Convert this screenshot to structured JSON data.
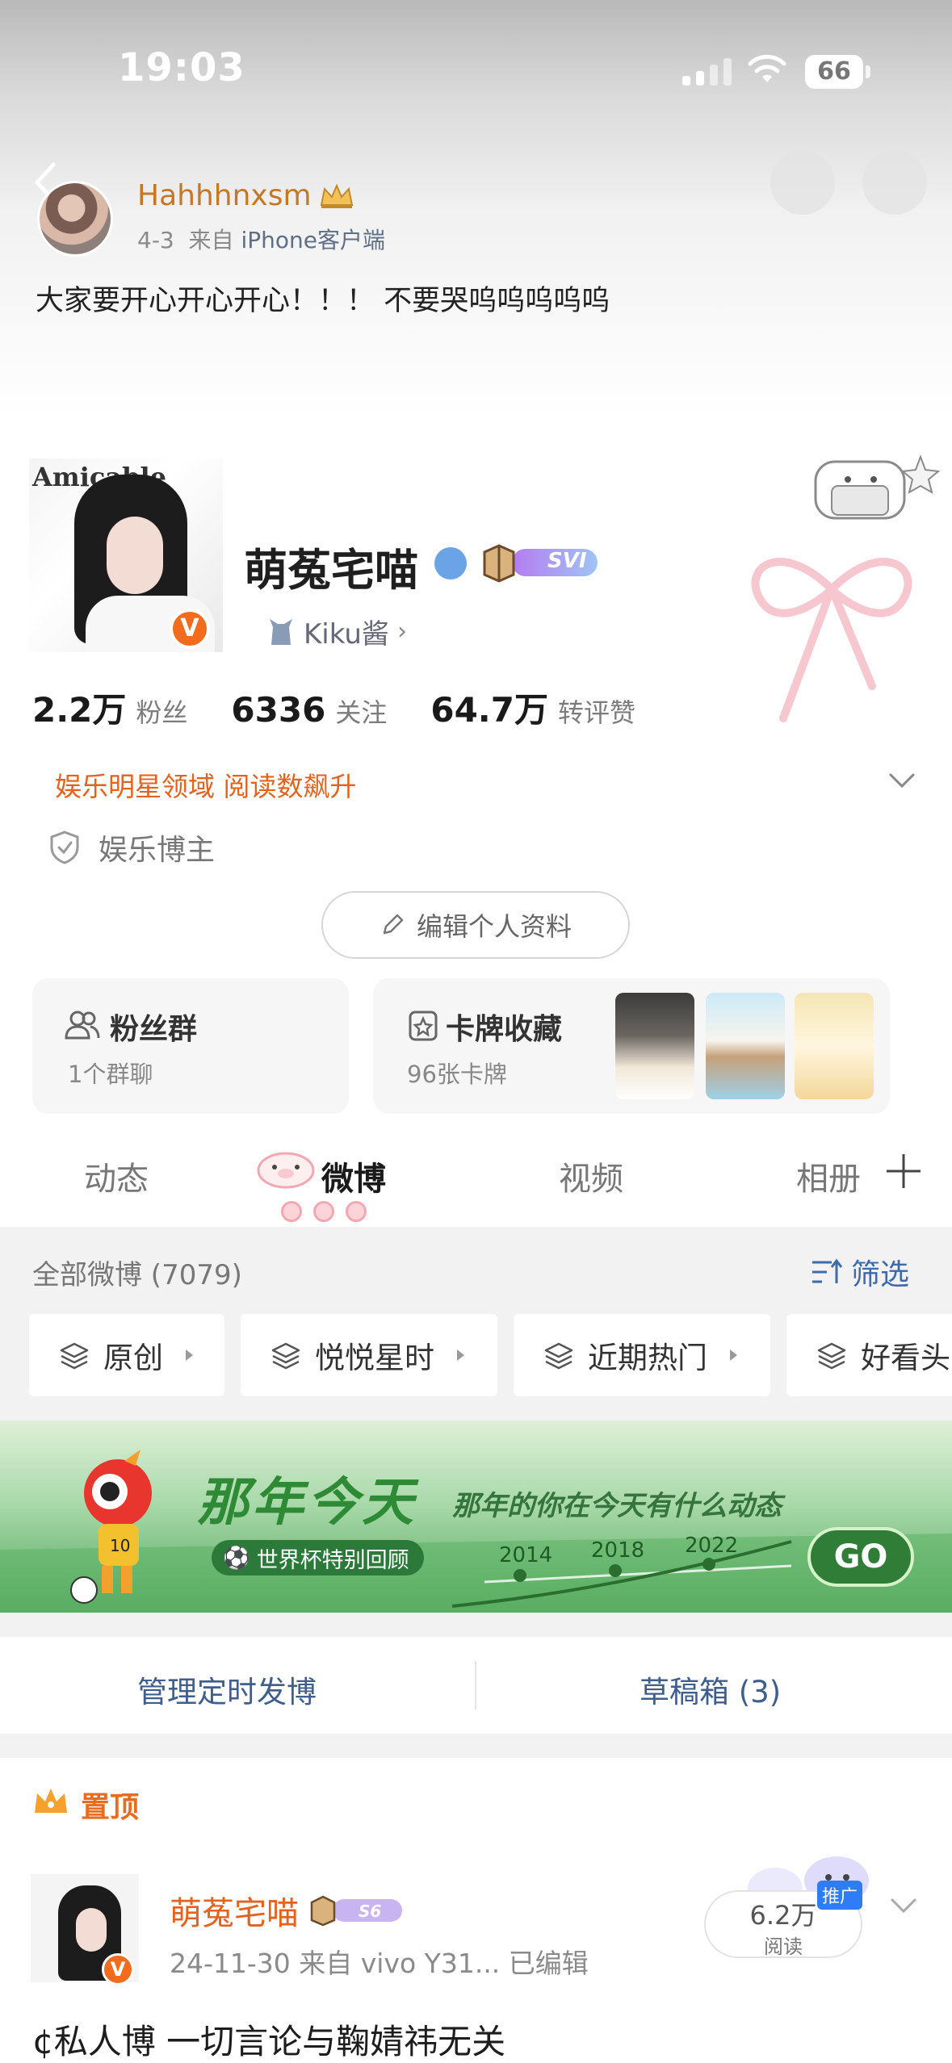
{
  "status_bar": {
    "time": "19:03",
    "battery": "66"
  },
  "repost": {
    "username": "Hahhhnxsm",
    "date": "4-3",
    "source_prefix": "来自",
    "source": "iPhone客户端",
    "text": "大家要开心开心开心！！！ 不要哭呜呜呜呜呜"
  },
  "profile": {
    "avatar_text": "Amicable",
    "name": "萌菟宅喵",
    "svip_label": "SVI",
    "ip_label": "Kiku酱",
    "stats": [
      {
        "num": "2.2万",
        "label": "粉丝"
      },
      {
        "num": "6336",
        "label": "关注"
      },
      {
        "num": "64.7万",
        "label": "转评赞"
      }
    ],
    "field": "娱乐明星领域 阅读数飙升",
    "blogger_type": "娱乐博主",
    "edit_button": "编辑个人资料"
  },
  "cards": {
    "fans_group": {
      "title": "粉丝群",
      "sub": "1个群聊"
    },
    "card_collection": {
      "title": "卡牌收藏",
      "sub": "96张卡牌"
    }
  },
  "tabs": [
    {
      "label": "动态"
    },
    {
      "label": "微博"
    },
    {
      "label": "视频"
    },
    {
      "label": "相册"
    }
  ],
  "feed": {
    "all_count": "全部微博 (7079)",
    "filter_label": "筛选",
    "chips": [
      "原创",
      "悦悦星时",
      "近期热门",
      "好看头"
    ]
  },
  "banner": {
    "title": "那年今天",
    "subtitle": "那年的你在今天有什么动态",
    "pill": "世界杯特别回顾",
    "years": [
      "2014",
      "2018",
      "2022"
    ],
    "go": "GO"
  },
  "manage": {
    "scheduled": "管理定时发博",
    "drafts": "草稿箱 (3)"
  },
  "pinned_post": {
    "pin_label": "置顶",
    "username": "萌菟宅喵",
    "badge": "S6",
    "meta": "24-11-30   来自 vivo Y31...   已编辑",
    "reads_num": "6.2万",
    "reads_label": "阅读",
    "promo": "推广",
    "text": "¢私人博 一切言论与鞠婧祎无关"
  },
  "colors": {
    "accent_orange": "#e2621e",
    "link_blue": "#3f5e8c",
    "brand_green": "#2f7d36"
  }
}
